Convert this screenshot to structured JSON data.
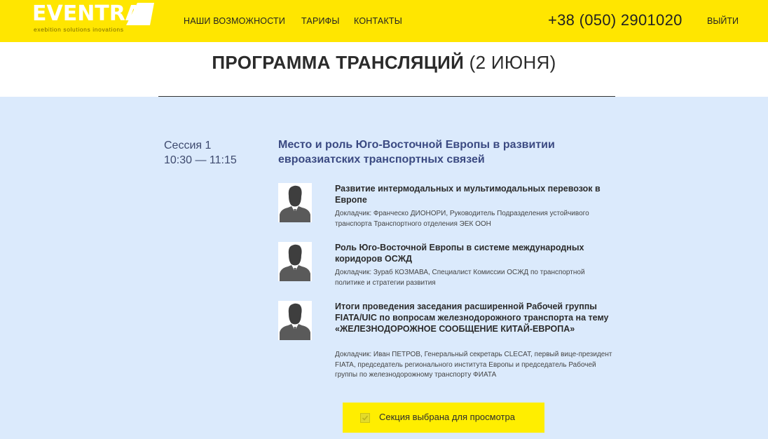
{
  "header": {
    "logo": {
      "word": "EVENTRA",
      "tagline": "exebition solutions inovations"
    },
    "nav": [
      {
        "label": "НАШИ ВОЗМОЖНОСТИ"
      },
      {
        "label": "ТАРИФЫ"
      },
      {
        "label": "КОНТАКТЫ"
      }
    ],
    "phone": "+38 (050) 2901020",
    "logout": "ВЫЙТИ"
  },
  "page": {
    "title_strong": "ПРОГРАММА ТРАНСЛЯЦИЙ",
    "title_light": " (2 ИЮНЯ)"
  },
  "session": {
    "label": "Сессия 1",
    "time": "10:30 — 11:15",
    "title": "Место и роль Юго-Восточной Европы в развитии евроазиатских транспортных связей",
    "talks": [
      {
        "title": "Развитие интермодальных и мультимодальных перевозок в Европе",
        "speaker": "Докладчик: Франческо ДИОНОРИ, Руководитель Подразделения устойчивого транспорта Транспортного отделения ЭЕК ООН"
      },
      {
        "title": "Роль Юго-Восточной Европы в системе международных коридоров ОСЖД",
        "speaker": "Докладчик: Зураб КОЗМАВА, Специалист Комиссии ОСЖД по транспортной политике и стратегии развития"
      },
      {
        "title": "Итоги проведения заседания расширенной Рабочей группы FIATA/UIC по вопросам железнодорожного транспорта на тему «ЖЕЛЕЗНОДОРОЖНОЕ СООБЩЕНИЕ КИТАЙ-ЕВРОПА»",
        "speaker": "Докладчик: Иван ПЕТРОВ, Генеральный секретарь CLECAT, первый вице-президент FIATA, председатель регионального института Европы и председатель Рабочей группы по железнодорожному транспорту ФИАТА"
      }
    ],
    "select_label": "Секция выбрана для просмотра",
    "selected": true
  },
  "colors": {
    "header_bg": "#ffe600",
    "main_bg": "#dbeafc",
    "session_title": "#3b4a82",
    "button_bg": "#ffee00"
  },
  "icons": {
    "avatar": "person-placeholder-icon",
    "checkbox": "checkbox-checked-icon"
  }
}
